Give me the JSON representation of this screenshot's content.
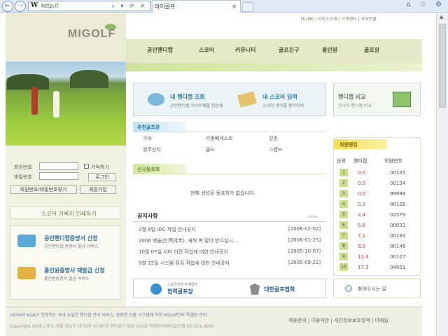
{
  "browser": {
    "back": "←",
    "forward": "→",
    "address_prefix": "W",
    "address": "http://",
    "address_icons": "⌕ ▾ ⟳ ✕",
    "tab_title": "마이골프",
    "tab_close": "✕",
    "right_icons": "⌂ ☆ ⚙"
  },
  "top_links": "HOME | 서비스소개 | 고객센터 | 사이트맵",
  "logo": "MIGOLF",
  "nav": [
    "공인핸디캡",
    "스코어",
    "커뮤니티",
    "골프친구",
    "홈인원",
    "골프장"
  ],
  "login": {
    "id_label": "회원번호",
    "pw_label": "비밀번호",
    "remember": "기억하기",
    "login_btn": "로그인",
    "find_btn": "회원번호/비밀번호찾기",
    "join_btn": "회원가입"
  },
  "left_banners": {
    "print": "스코어 기록지 인쇄하기",
    "cert": "공인핸디캡증명서 신청",
    "cert_sub": "공인핸디캡 증명서 발급 서비스",
    "hio": "홀인원증명서 재발급 신청",
    "hio_sub": "홀인원증명서 발급 서비스"
  },
  "main_boxes": {
    "hcp_title": "내 핸디캡 조회",
    "hcp_sub": "공인핸디캡 리스트예를 한눈에",
    "score_title": "내 스코어 입력",
    "score_sub": "스코어 관리를 편리하게",
    "compare_title": "핸디캡 비교",
    "compare_sub": "한국의 핸디캡 비교"
  },
  "recommend": {
    "title": "추천골프장",
    "items": [
      "가야",
      "가평베네스트",
      "강촌",
      "경주신라",
      "골드",
      "그랜드"
    ]
  },
  "club": {
    "title": "신규동호회",
    "empty": "현재 생성된 동호회가 없습니다."
  },
  "notice": {
    "title": "공지사항",
    "more": "more",
    "rows": [
      {
        "t": "2월 8일 IDC 작업 안내공지",
        "d": "[2006-02-02]"
      },
      {
        "t": "2006 병술년(丙戌年), 새해 복 많이 받으십시...",
        "d": "[2006-01-25]"
      },
      {
        "t": "10월 07일 서버 이전 작업에 대한 안내공지",
        "d": "[2005-10-07]"
      },
      {
        "t": "9월 22일 시스템 점검 작업에 대한 안내공지",
        "d": "[2005-09-22]"
      }
    ]
  },
  "bottom_banners": {
    "coop_sub": "스포츠마케 추계협약",
    "coop": "협력골프장",
    "kgu": "대한골프협회",
    "find": "찾아오시는 길"
  },
  "ranking": {
    "title": "최원랭킹",
    "headers": [
      "순위",
      "핸디캡",
      "회원번호"
    ],
    "rows": [
      {
        "n": "1",
        "h": "0.0",
        "m": "00135"
      },
      {
        "n": "2",
        "h": "0.0",
        "m": "00134"
      },
      {
        "n": "3",
        "h": "0.0",
        "m": "99999"
      },
      {
        "n": "4",
        "h": "0.2",
        "m": "00126"
      },
      {
        "n": "5",
        "h": "2.4",
        "m": "02579"
      },
      {
        "n": "6",
        "h": "5.6",
        "m": "00033"
      },
      {
        "n": "7",
        "h": "7.1",
        "m": "00184"
      },
      {
        "n": "8",
        "h": "9.5",
        "m": "00146"
      },
      {
        "n": "9",
        "h": "11.3",
        "m": "00127"
      },
      {
        "n": "10",
        "h": "17.3",
        "m": "04001"
      }
    ]
  },
  "footer": {
    "line1": "USGA와 KGA가 인정하는 국내 유일한 핸디캡 관리 서비스, 정확한 산출 시스템에 의한 MiGolf만의 특별한 관리",
    "line2": "Copyright 2005 / 주소:서울 강남구 대치2동 914번지 한마살기 빌딩 501호 지파인터내셔널/전화:02-501-9900",
    "links": "제휴문의 | 이용약관 | 개인정보보호정책 | 이메일"
  }
}
